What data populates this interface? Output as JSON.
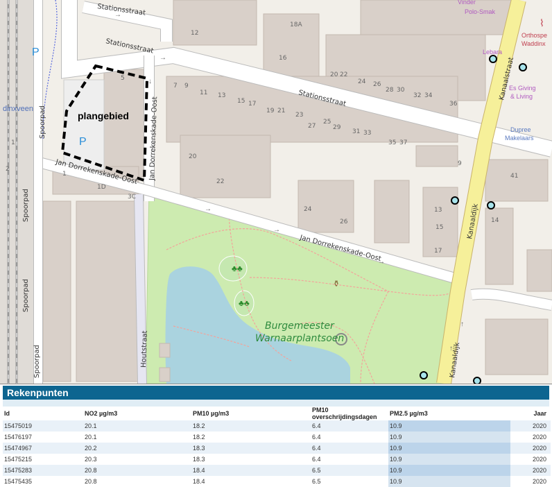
{
  "map": {
    "area_label": "plangebied",
    "parking_symbol": "P",
    "park_name_line1": "Burgemeester",
    "park_name_line2": "Warnaarplantsoen",
    "streets": {
      "stationsstraat_top": "Stationsstraat",
      "stationsstraat_mid": "Stationsstraat",
      "stationsstraat_right": "Stationsstraat",
      "jan_dorrekenskade_oost_vertical": "Jan Dorrekenskade-Oost",
      "jan_dorrekenskade_oost_left": "Jan Dorrekenskade-Oost",
      "jan_dorrekenskade_oost_right": "Jan Dorrekenskade-Oost",
      "spoorpad_top": "Spoorpad",
      "spoorpad_mid": "Spoorpad",
      "spoorpad_bottom": "Spoorpad",
      "houtstraat": "Houtstraat",
      "kanaalstraat": "Kanaalstraat",
      "kanaaldijk_mid": "Kanaaldijk",
      "kanaaldijk_bottom": "Kanaaldijk"
    },
    "pois": {
      "station_label": "dinxveen",
      "vinder": "Vinder",
      "polo_smak": "Polo-Smak",
      "lebara": "Lebara",
      "orthospe": "Orthospe",
      "waddinx": "Waddinx",
      "es_giving_1": "Es Giving",
      "es_giving_2": "& Living",
      "dupree_1": "Dupree",
      "dupree_2": "Makelaars"
    },
    "house_numbers": {
      "n12": "12",
      "n18a": "18A",
      "n16": "16",
      "n20": "20",
      "n22a": "22",
      "n24a": "24",
      "n26a": "26",
      "n28": "28",
      "n30": "30",
      "n32": "32",
      "n34": "34",
      "n36": "36",
      "n5": "5",
      "n7": "7",
      "n9": "9",
      "n11": "11",
      "n13": "13",
      "n15": "15",
      "n17": "17",
      "n19": "19",
      "n21": "21",
      "n23": "23",
      "n25": "25",
      "n27": "27",
      "n29": "29",
      "n31": "31",
      "n33": "33",
      "n35": "35",
      "n37": "37",
      "n9r": "9",
      "n20b": "20",
      "n22": "22",
      "n24": "24",
      "n26": "26",
      "n41": "41",
      "n1": "1",
      "n1d": "1D",
      "n3c": "3C",
      "n13r": "13",
      "n14": "14",
      "n15r": "15",
      "n17r": "17",
      "n1s": "1",
      "n2s": "2"
    }
  },
  "panel": {
    "title": "Rekenpunten",
    "headers": {
      "id": "Id",
      "no2": "NO2 µg/m3",
      "pm10": "PM10 µg/m3",
      "pm10_days": "PM10 overschrijdingsdagen",
      "pm25": "PM2.5 µg/m3",
      "jaar": "Jaar"
    },
    "rows": [
      {
        "id": "15475019",
        "no2": "20.1",
        "pm10": "18.2",
        "pm10_days": "6.4",
        "pm25": "10.9",
        "jaar": "2020"
      },
      {
        "id": "15476197",
        "no2": "20.1",
        "pm10": "18.2",
        "pm10_days": "6.4",
        "pm25": "10.9",
        "jaar": "2020"
      },
      {
        "id": "15474967",
        "no2": "20.2",
        "pm10": "18.3",
        "pm10_days": "6.4",
        "pm25": "10.9",
        "jaar": "2020"
      },
      {
        "id": "15475215",
        "no2": "20.3",
        "pm10": "18.3",
        "pm10_days": "6.4",
        "pm25": "10.9",
        "jaar": "2020"
      },
      {
        "id": "15475283",
        "no2": "20.8",
        "pm10": "18.4",
        "pm10_days": "6.5",
        "pm25": "10.9",
        "jaar": "2020"
      },
      {
        "id": "15475435",
        "no2": "20.8",
        "pm10": "18.4",
        "pm10_days": "6.5",
        "pm25": "10.9",
        "jaar": "2020"
      }
    ]
  }
}
